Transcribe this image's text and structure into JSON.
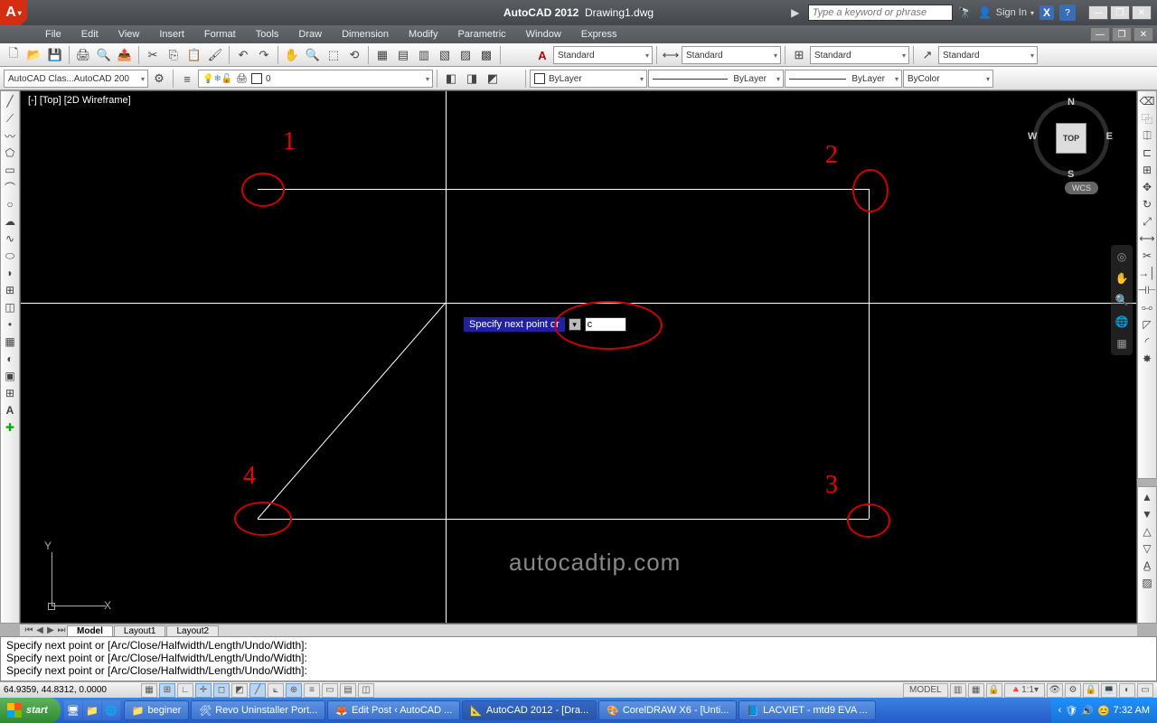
{
  "title": {
    "app": "AutoCAD 2012",
    "doc": "Drawing1.dwg"
  },
  "search_placeholder": "Type a keyword or phrase",
  "signin_label": "Sign In",
  "menus": [
    "File",
    "Edit",
    "View",
    "Insert",
    "Format",
    "Tools",
    "Draw",
    "Dimension",
    "Modify",
    "Parametric",
    "Window",
    "Express"
  ],
  "row2": {
    "workspace_sel": "AutoCAD Clas...AutoCAD 200",
    "layer_sel": "0",
    "style_labels": [
      "Standard",
      "Standard",
      "Standard",
      "Standard"
    ],
    "bylayer": "ByLayer",
    "bylayer2": "ByLayer",
    "bylayer3": "ByLayer",
    "bycolor": "ByColor"
  },
  "viewport_label": "[-] [Top] [2D Wireframe]",
  "viewcube": {
    "face": "TOP",
    "n": "N",
    "s": "S",
    "e": "E",
    "w": "W",
    "wcs": "WCS"
  },
  "annotations": {
    "p1": "1",
    "p2": "2",
    "p3": "3",
    "p4": "4"
  },
  "dyn_prompt": "Specify next point or",
  "dyn_value": "c",
  "watermark": "autocadtip.com",
  "tabs": {
    "model": "Model",
    "l1": "Layout1",
    "l2": "Layout2"
  },
  "cmd_lines": [
    "Specify next point or [Arc/Close/Halfwidth/Length/Undo/Width]:",
    "Specify next point or [Arc/Close/Halfwidth/Length/Undo/Width]:",
    "",
    "Specify next point or [Arc/Close/Halfwidth/Length/Undo/Width]:"
  ],
  "status": {
    "coords": "64.9359, 44.8312, 0.0000",
    "model": "MODEL",
    "scale": "1:1"
  },
  "taskbar": {
    "start": "start",
    "items": [
      "beginer",
      "Revo Uninstaller Port...",
      "Edit Post ‹ AutoCAD ...",
      "AutoCAD 2012 - [Dra...",
      "CorelDRAW X6 - [Unti...",
      "LACVIET - mtd9 EVA ..."
    ],
    "clock": "7:32 AM"
  }
}
